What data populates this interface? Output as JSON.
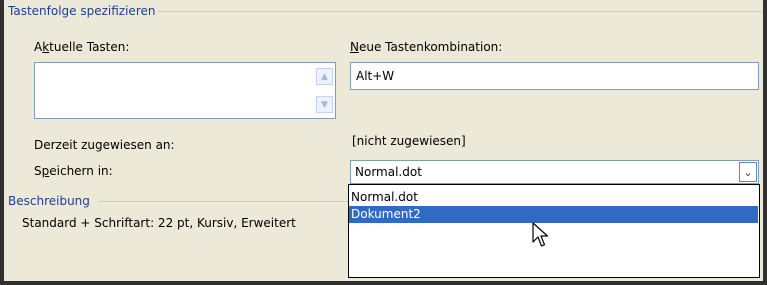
{
  "key_sequence": {
    "group_title": "Tastenfolge spezifizieren",
    "current_keys_label": "Aktuelle Tasten:",
    "new_shortcut_label": "Neue Tastenkombination:",
    "new_shortcut_value": "Alt+W",
    "currently_assigned_label": "Derzeit zugewiesen an:",
    "currently_assigned_value": "[nicht zugewiesen]",
    "save_in_label": "Speichern in:",
    "save_in_value": "Normal.dot",
    "save_in_options": [
      "Normal.dot",
      "Dokument2"
    ],
    "save_in_highlighted": "Dokument2"
  },
  "description": {
    "group_title": "Beschreibung",
    "text": "Standard + Schriftart: 22 pt, Kursiv, Erweitert"
  },
  "icons": {
    "scroll_up": "scroll-up-arrow-icon",
    "scroll_down": "scroll-down-arrow-icon",
    "dropdown": "chevron-down-icon",
    "cursor": "mouse-pointer-icon"
  },
  "colors": {
    "dialog_background": "#ece9d8",
    "group_title": "#1f3d9a",
    "selection": "#316ac5",
    "field_border": "#7f9db9"
  }
}
